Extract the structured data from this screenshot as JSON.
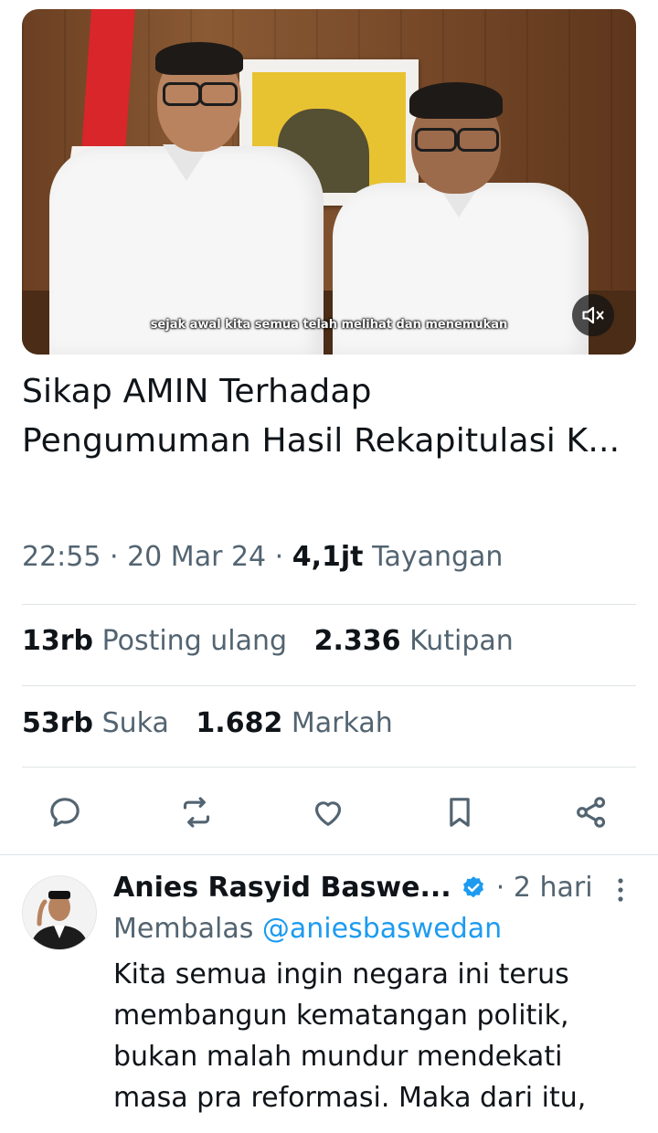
{
  "video": {
    "subtitle": "sejak awal kita semua telah melihat dan menemukan",
    "mute_icon": "speaker-muted-icon"
  },
  "post": {
    "title_line1": "Sikap AMIN Terhadap",
    "title_line2": "Pengumuman Hasil Rekapitulasi K...",
    "time": "22:55",
    "date": "20 Mar 24",
    "views_count": "4,1jt",
    "views_label": "Tayangan",
    "reposts_count": "13rb",
    "reposts_label": "Posting ulang",
    "quotes_count": "2.336",
    "quotes_label": "Kutipan",
    "likes_count": "53rb",
    "likes_label": "Suka",
    "bookmarks_count": "1.682",
    "bookmarks_label": "Markah"
  },
  "actions": [
    "reply-icon",
    "repost-icon",
    "like-icon",
    "bookmark-icon",
    "share-icon"
  ],
  "reply": {
    "author": "Anies Rasyid Baswe...",
    "time": "2 hari",
    "replying_prefix": "Membalas",
    "replying_handle": "@aniesbaswedan",
    "body": "Kita semua ingin negara ini terus membangun kematangan politik, bukan malah mundur mendekati masa pra reformasi. Maka dari itu,"
  },
  "colors": {
    "text": "#0f1419",
    "secondary": "#536471",
    "accent": "#1d9bf0",
    "divider": "#dfe3e6"
  }
}
